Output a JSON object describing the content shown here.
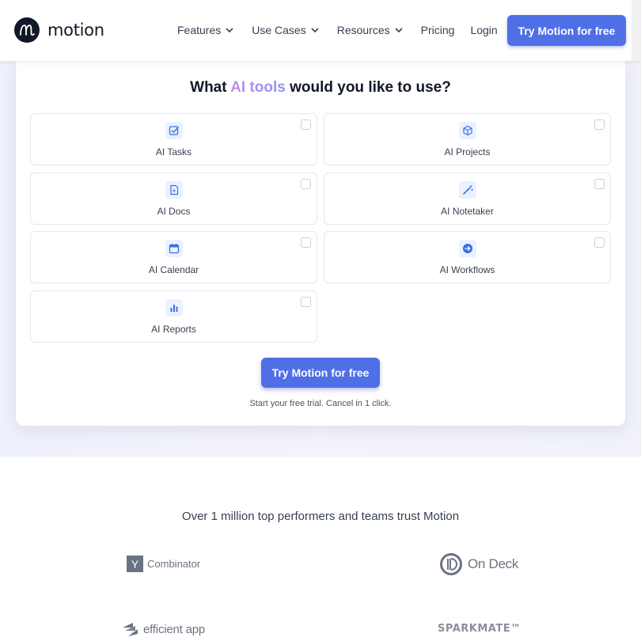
{
  "brand": {
    "name": "motion"
  },
  "nav": {
    "items": [
      {
        "label": "Features",
        "dropdown": true
      },
      {
        "label": "Use Cases",
        "dropdown": true
      },
      {
        "label": "Resources",
        "dropdown": true
      },
      {
        "label": "Pricing",
        "dropdown": false
      },
      {
        "label": "Login",
        "dropdown": false
      }
    ],
    "cta": "Try Motion for free"
  },
  "hero": {
    "question_prefix": "What ",
    "question_accent": "AI tools",
    "question_suffix": " would you like to use?",
    "tools": [
      {
        "label": "AI Tasks",
        "icon": "task-check-icon",
        "checked": false
      },
      {
        "label": "AI Projects",
        "icon": "cube-icon",
        "checked": false
      },
      {
        "label": "AI Docs",
        "icon": "document-sparkle-icon",
        "checked": false
      },
      {
        "label": "AI Notetaker",
        "icon": "magic-wand-icon",
        "checked": false
      },
      {
        "label": "AI Calendar",
        "icon": "calendar-icon",
        "checked": false
      },
      {
        "label": "AI Workflows",
        "icon": "arrow-circle-icon",
        "checked": false
      },
      {
        "label": "AI Reports",
        "icon": "bar-chart-icon",
        "checked": false
      }
    ],
    "cta": "Try Motion for free",
    "subtext": "Start your free trial. Cancel in 1 click."
  },
  "trust": {
    "heading": "Over 1 million top performers and teams trust Motion",
    "logos": {
      "yc_mark": "Y",
      "yc_text": "Combinator",
      "ondeck": "On Deck",
      "efficient": "efficient app",
      "sparkmate": "SPARKMATE™"
    }
  },
  "colors": {
    "accent": "#4f6fe6",
    "icon_blue": "#3b6fe0",
    "icon_bg": "#eaf1ff"
  }
}
